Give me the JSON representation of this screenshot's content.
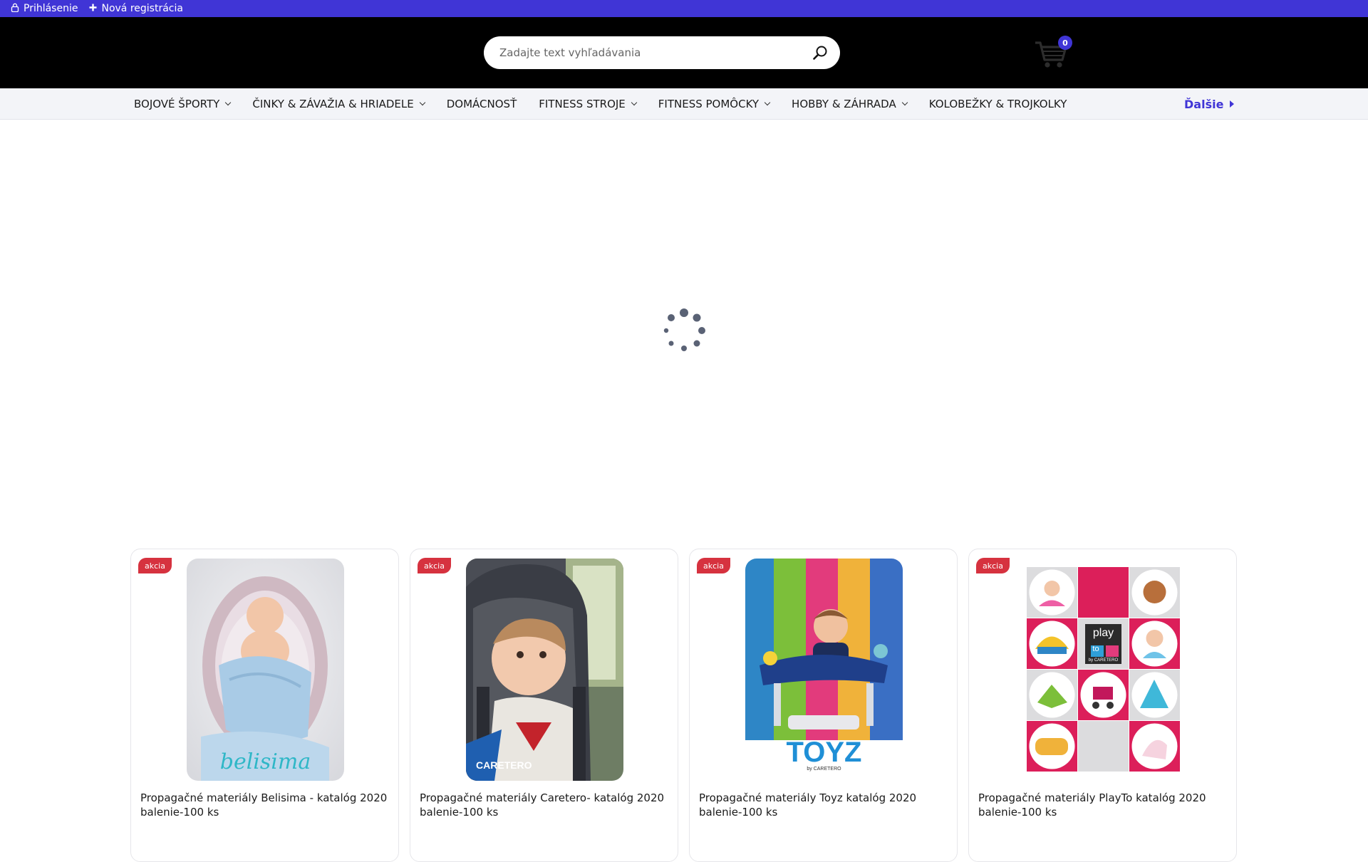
{
  "topbar": {
    "login_label": "Prihlásenie",
    "register_label": "Nová registrácia"
  },
  "header": {
    "search_placeholder": "Zadajte text vyhľadávania",
    "cart_count": "0"
  },
  "nav": {
    "items": [
      {
        "label": "BOJOVÉ ŠPORTY",
        "dropdown": true
      },
      {
        "label": "ČINKY & ZÁVAŽIA & HRIADELE",
        "dropdown": true
      },
      {
        "label": "DOMÁCNOSŤ",
        "dropdown": false
      },
      {
        "label": "FITNESS STROJE",
        "dropdown": true
      },
      {
        "label": "FITNESS POMÔCKY",
        "dropdown": true
      },
      {
        "label": "HOBBY & ZÁHRADA",
        "dropdown": true
      },
      {
        "label": "KOLOBEŽKY & TROJKOLKY",
        "dropdown": false
      }
    ],
    "more_label": "Ďalšie"
  },
  "products": [
    {
      "badge": "akcia",
      "title": "Propagačné materiály Belisima - katalóg 2020 balenie-100 ks",
      "image": "belisima-baby-nest"
    },
    {
      "badge": "akcia",
      "title": "Propagačné materiály Caretero- katalóg 2020 balenie-100 ks",
      "image": "caretero-car-seat"
    },
    {
      "badge": "akcia",
      "title": "Propagačné materiály Toyz katalóg 2020 balenie-100 ks",
      "image": "toyz-activity-walker"
    },
    {
      "badge": "akcia",
      "title": "Propagačné materiály PlayTo katalóg 2020 balenie-100 ks",
      "image": "playto-toy-grid"
    }
  ],
  "logos": {
    "belisima": "belisima",
    "caretero": "CARETERO",
    "toyz": "TOYZ",
    "toyz_sub": "by CARETERO",
    "playto_a": "play",
    "playto_b": "to",
    "playto_sub": "by CARETERO"
  },
  "colors": {
    "accent": "#4035d6",
    "header_bg": "#000000",
    "nav_bg": "#f3f4f8",
    "sale_badge": "#d6323f"
  }
}
